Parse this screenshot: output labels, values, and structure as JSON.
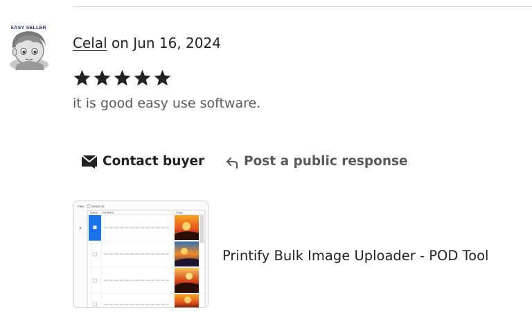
{
  "review": {
    "reviewer": "Celal",
    "date_text": "on Jun 16, 2024",
    "rating": 5,
    "text": "it is good easy use software.",
    "avatar_badge": "EASY SELLER"
  },
  "actions": {
    "contact_label": "Contact buyer",
    "response_label": "Post a public response"
  },
  "product": {
    "title": "Printify Bulk Image Uploader - POD Tool",
    "thumbnail_header": {
      "menu": "Files",
      "select_all": "Select All",
      "col_upload": "Upload",
      "col_filename": "File Name",
      "col_image": "Image"
    }
  },
  "colors": {
    "text": "#222222",
    "muted_text": "#595959",
    "divider": "#d9d9d9",
    "thumb_highlight": "#1a73e8"
  },
  "icons": [
    "envelope-icon",
    "reply-arrow-icon",
    "star-icon"
  ]
}
